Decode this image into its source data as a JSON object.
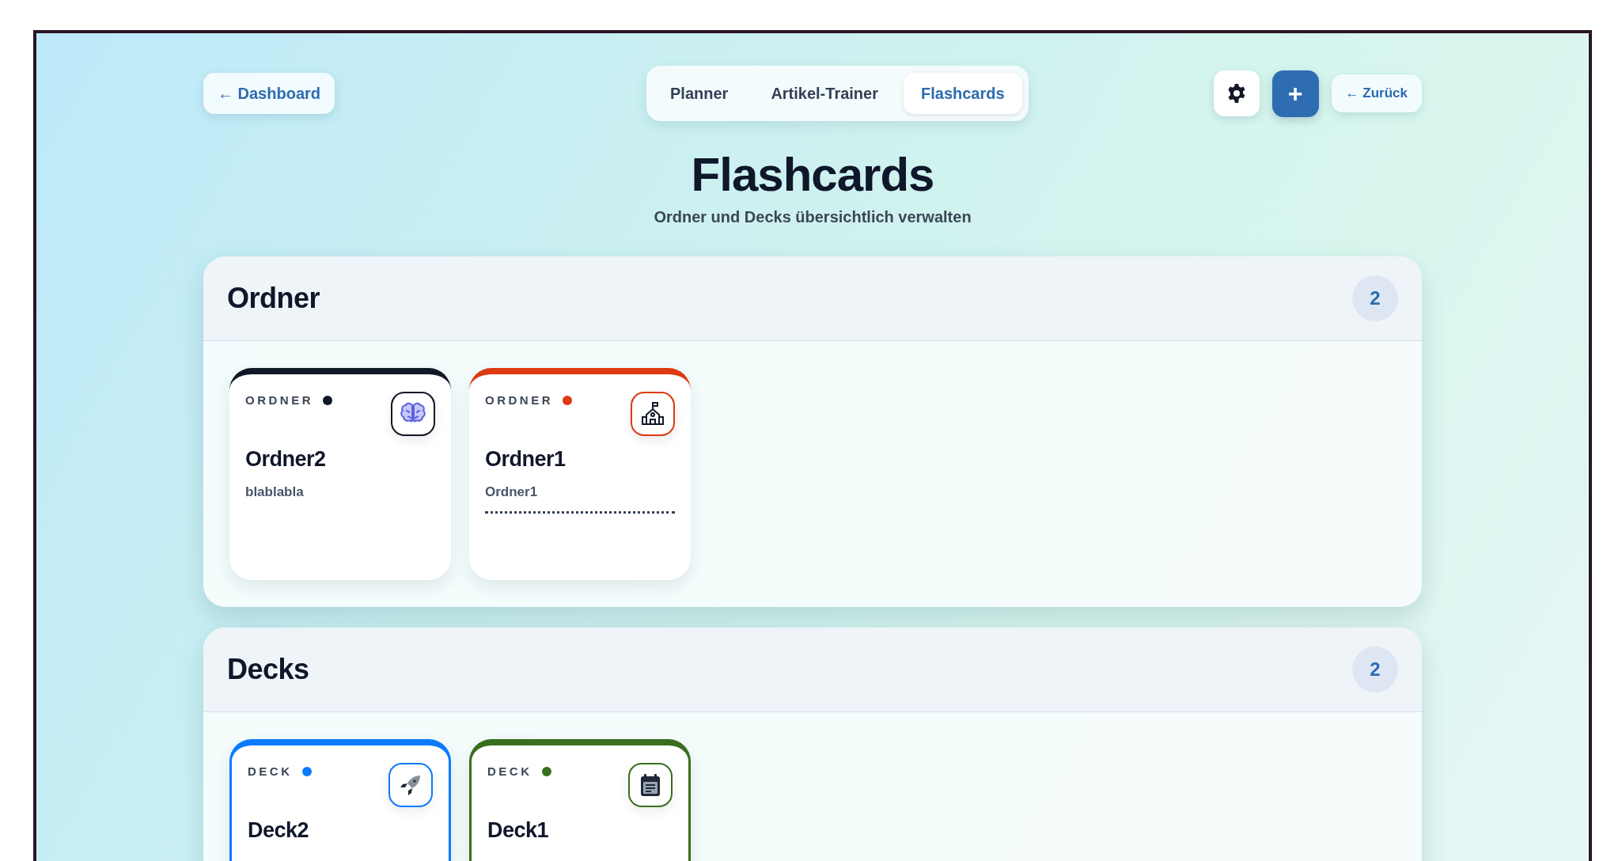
{
  "nav": {
    "back_button": "← Dashboard",
    "tabs": [
      {
        "label": "Planner",
        "selected": false
      },
      {
        "label": "Artikel-Trainer",
        "selected": false
      },
      {
        "label": "Flashcards",
        "selected": true
      }
    ],
    "add_button": "+",
    "back_link": "← Zurück"
  },
  "header": {
    "title": "Flashcards",
    "subtitle": "Ordner und Decks übersichtlich verwalten"
  },
  "sections": [
    {
      "title": "Ordner",
      "count": "2",
      "items": [
        {
          "kind": "folder",
          "type_label": "ORDNER",
          "color": "#111827",
          "name": "Ordner2",
          "description": "blablabla",
          "dotted_rule": false
        },
        {
          "kind": "folder",
          "type_label": "ORDNER",
          "color": "#dc3a12",
          "name": "Ordner1",
          "description": "Ordner1",
          "dotted_rule": true
        }
      ]
    },
    {
      "title": "Decks",
      "count": "2",
      "items": [
        {
          "kind": "deck",
          "type_label": "DECK",
          "color": "#0a7bff",
          "name": "Deck2"
        },
        {
          "kind": "deck",
          "type_label": "DECK",
          "color": "#3a6e1f",
          "name": "Deck1"
        }
      ]
    }
  ]
}
